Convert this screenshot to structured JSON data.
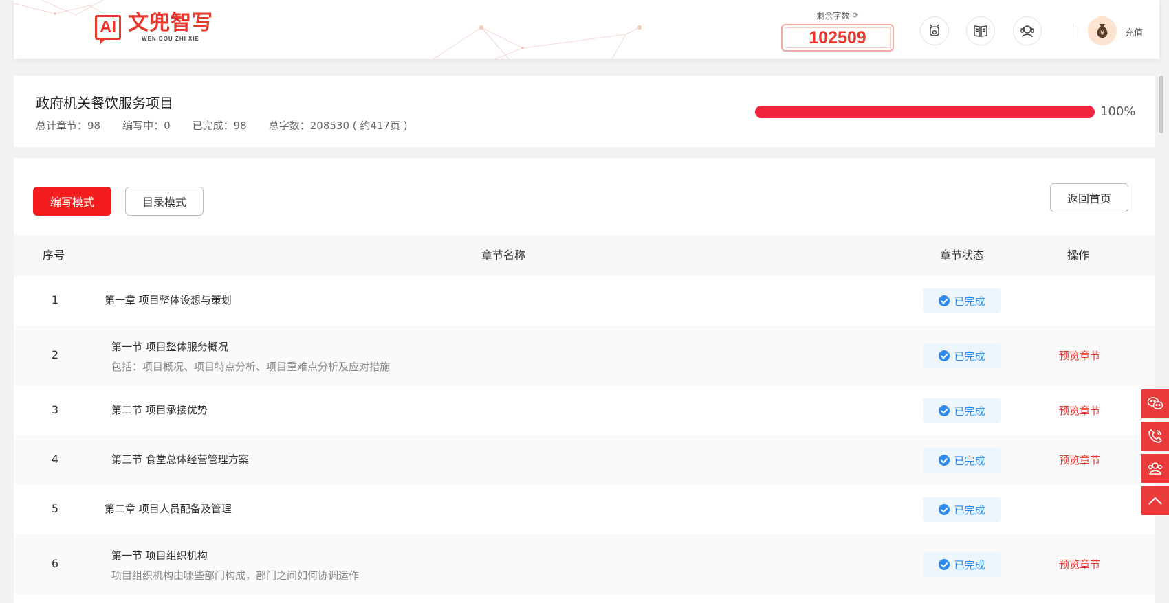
{
  "header": {
    "logo_mark": "AI",
    "logo_cn": "文兜智写",
    "logo_en": "WEN DOU ZHI XIE",
    "words_label": "剩余字数",
    "words_count": "102509",
    "icons": [
      "gift-icon",
      "book-icon",
      "support-icon"
    ],
    "recharge_label": "充值"
  },
  "project": {
    "title": "政府机关餐饮服务项目",
    "stats": {
      "total": "总计章节：98",
      "writing": "编写中：0",
      "done": "已完成：98",
      "words": "总字数：208530 ( 约417页 )"
    },
    "progress": 100,
    "progress_text": "100%"
  },
  "toolbar": {
    "write_mode": "编写模式",
    "catalog_mode": "目录模式",
    "back_home": "返回首页"
  },
  "table": {
    "headers": {
      "no": "序号",
      "name": "章节名称",
      "status": "章节状态",
      "op": "操作"
    },
    "rows": [
      {
        "no": "1",
        "name": "第一章 项目整体设想与策划",
        "desc": "",
        "level": "chapter",
        "status": "已完成",
        "op": ""
      },
      {
        "no": "2",
        "name": "第一节 项目整体服务概况",
        "desc": "包括：项目概况、项目特点分析、项目重难点分析及应对措施",
        "level": "section",
        "status": "已完成",
        "op": "预览章节"
      },
      {
        "no": "3",
        "name": "第二节 项目承接优势",
        "desc": "",
        "level": "section",
        "status": "已完成",
        "op": "预览章节"
      },
      {
        "no": "4",
        "name": "第三节 食堂总体经营管理方案",
        "desc": "",
        "level": "section",
        "status": "已完成",
        "op": "预览章节"
      },
      {
        "no": "5",
        "name": "第二章 项目人员配备及管理",
        "desc": "",
        "level": "chapter",
        "status": "已完成",
        "op": ""
      },
      {
        "no": "6",
        "name": "第一节 项目组织机构",
        "desc": "项目组织机构由哪些部门构成，部门之间如何协调运作",
        "level": "section",
        "status": "已完成",
        "op": "预览章节"
      }
    ]
  },
  "side_buttons": [
    "wechat-icon",
    "phone-icon",
    "group-icon",
    "back-to-top-icon"
  ],
  "colors": {
    "brand": "#e8372d",
    "primary_button": "#f31d1d",
    "progress": "#f0253d",
    "status_blue": "#2b8bea",
    "float_red": "#ea3b3b"
  }
}
